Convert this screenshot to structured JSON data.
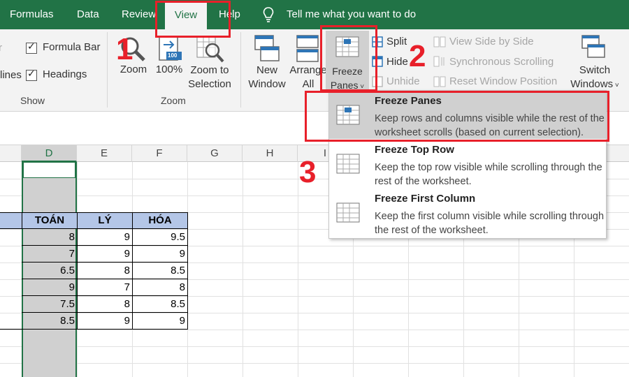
{
  "tabs": {
    "formulas": "Formulas",
    "data": "Data",
    "review": "Review",
    "view": "View",
    "help": "Help",
    "tell_me": "Tell me what you want to do"
  },
  "show_group": {
    "formula_bar": "Formula Bar",
    "gridlines_partial": "lines",
    "headings": "Headings",
    "label": "Show",
    "left_partial_glyph": "r"
  },
  "zoom_group": {
    "zoom": "Zoom",
    "hundred": "100%",
    "hundred_badge": "100",
    "zoom_to_line1": "Zoom to",
    "zoom_to_line2": "Selection",
    "label": "Zoom"
  },
  "window_group": {
    "new_line1": "New",
    "new_line2": "Window",
    "arrange_line1": "Arrange",
    "arrange_line2": "All",
    "freeze_line1": "Freeze",
    "freeze_line2": "Panes",
    "split": "Split",
    "hide": "Hide",
    "unhide": "Unhide",
    "view_side": "View Side by Side",
    "sync_scroll": "Synchronous Scrolling",
    "reset_pos": "Reset Window Position",
    "switch_line1": "Switch",
    "switch_line2": "Windows"
  },
  "columns": [
    "D",
    "E",
    "F",
    "G",
    "H",
    "I"
  ],
  "table": {
    "headers": [
      "TOÁN",
      "LÝ",
      "HÓA"
    ],
    "rows": [
      [
        "8",
        "9",
        "9.5"
      ],
      [
        "7",
        "9",
        "9"
      ],
      [
        "6.5",
        "8",
        "8.5"
      ],
      [
        "9",
        "7",
        "8"
      ],
      [
        "7.5",
        "8",
        "8.5"
      ],
      [
        "8.5",
        "9",
        "9"
      ]
    ]
  },
  "dropdown": {
    "items": [
      {
        "title": "Freeze Panes",
        "desc": "Keep rows and columns visible while the rest of the worksheet scrolls (based on current selection)."
      },
      {
        "title": "Freeze Top Row",
        "desc": "Keep the top row visible while scrolling through the rest of the worksheet."
      },
      {
        "title": "Freeze First Column",
        "desc": "Keep the first column visible while scrolling through the rest of the worksheet."
      }
    ]
  },
  "annotations": {
    "step1": "1",
    "step2": "2",
    "step3": "3"
  },
  "colors": {
    "excel_green": "#217346",
    "ribbon_bg": "#f3f3f3",
    "header_blue": "#b4c6e7",
    "annotation_red": "#e8202a",
    "selected_gray": "#d0d0d0"
  }
}
